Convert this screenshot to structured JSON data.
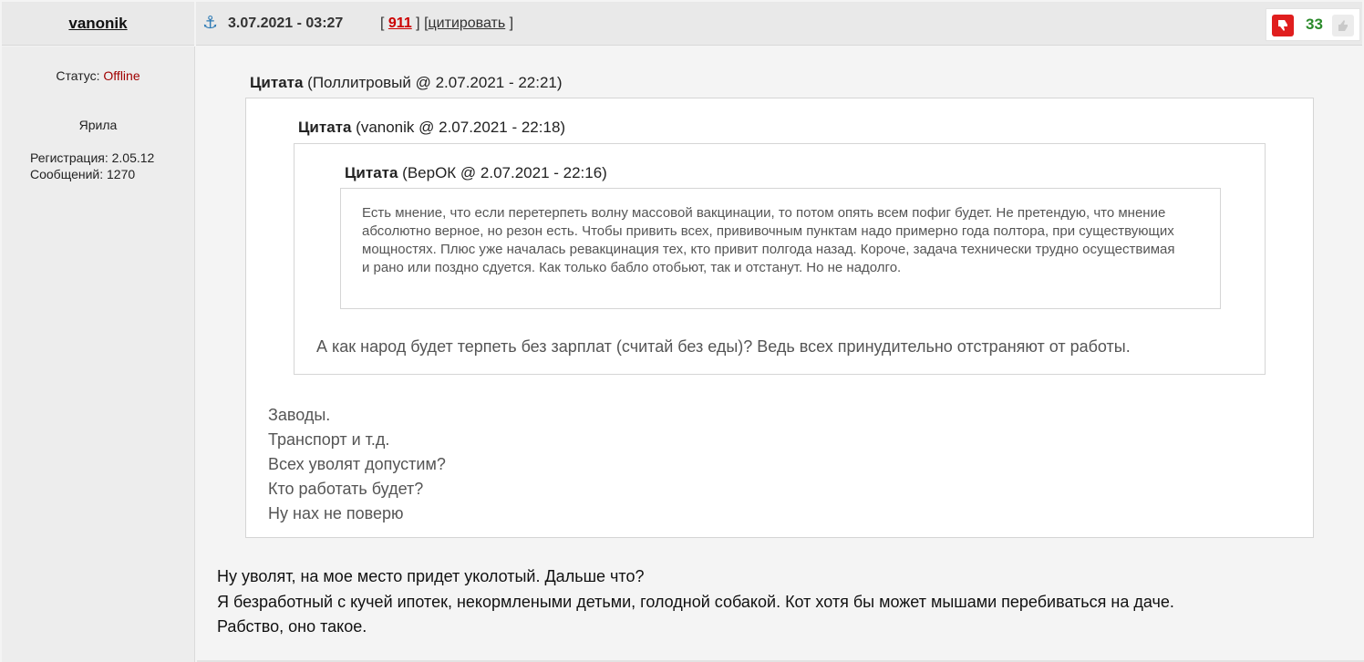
{
  "author": {
    "name": "vanonik"
  },
  "header": {
    "anchor_icon": "anchor-icon",
    "date": "3.07.2021 - 03:27",
    "bracket_open_1": "[",
    "post_number": "911",
    "bracket_mid": "] [",
    "quote_link": "цитировать",
    "bracket_close": "]"
  },
  "rating": {
    "thumb_down_icon": "thumbs-down-icon",
    "score": "33",
    "thumb_up_icon": "thumbs-up-icon",
    "score_color": "#2a8a2a"
  },
  "sidebar": {
    "status_label": "Статус: ",
    "status_value": "Offline",
    "rank": "Ярила",
    "registration": "Регистрация: 2.05.12",
    "messages": "Сообщений: 1270"
  },
  "quotes": {
    "q1": {
      "label": "Цитата",
      "meta": " (Поллитровый @ 2.07.2021 - 22:21)",
      "lines": [
        "Заводы.",
        "Транспорт и т.д.",
        "Всех уволят допустим?",
        "Кто работать будет?",
        "Ну нах не поверю"
      ]
    },
    "q2": {
      "label": "Цитата",
      "meta": " (vanonik @ 2.07.2021 - 22:18)",
      "text": "А как народ будет терпеть без зарплат (считай без еды)? Ведь всех принудительно отстраняют от работы."
    },
    "q3": {
      "label": "Цитата",
      "meta": " (ВерОК @ 2.07.2021 - 22:16)",
      "text": "Есть мнение, что если перетерпеть волну массовой вакцинации, то потом опять всем пофиг будет. Не претендую, что мнение абсолютно верное, но резон есть. Чтобы привить всех, прививочным пунктам надо примерно года полтора, при существующих мощностях. Плюс уже началась ревакцинация тех, кто привит полгода назад. Короче, задача технически трудно осуществимая и рано или поздно сдуется. Как только бабло отобьют, так и отстанут. Но не надолго."
    }
  },
  "message": {
    "lines": [
      "Ну уволят, на мое место придет уколотый. Дальше что?",
      "Я безработный с кучей ипотек, некормлеными детьми, голодной собакой. Кот хотя бы может мышами перебиваться на даче.",
      "Рабство, оно такое."
    ]
  }
}
